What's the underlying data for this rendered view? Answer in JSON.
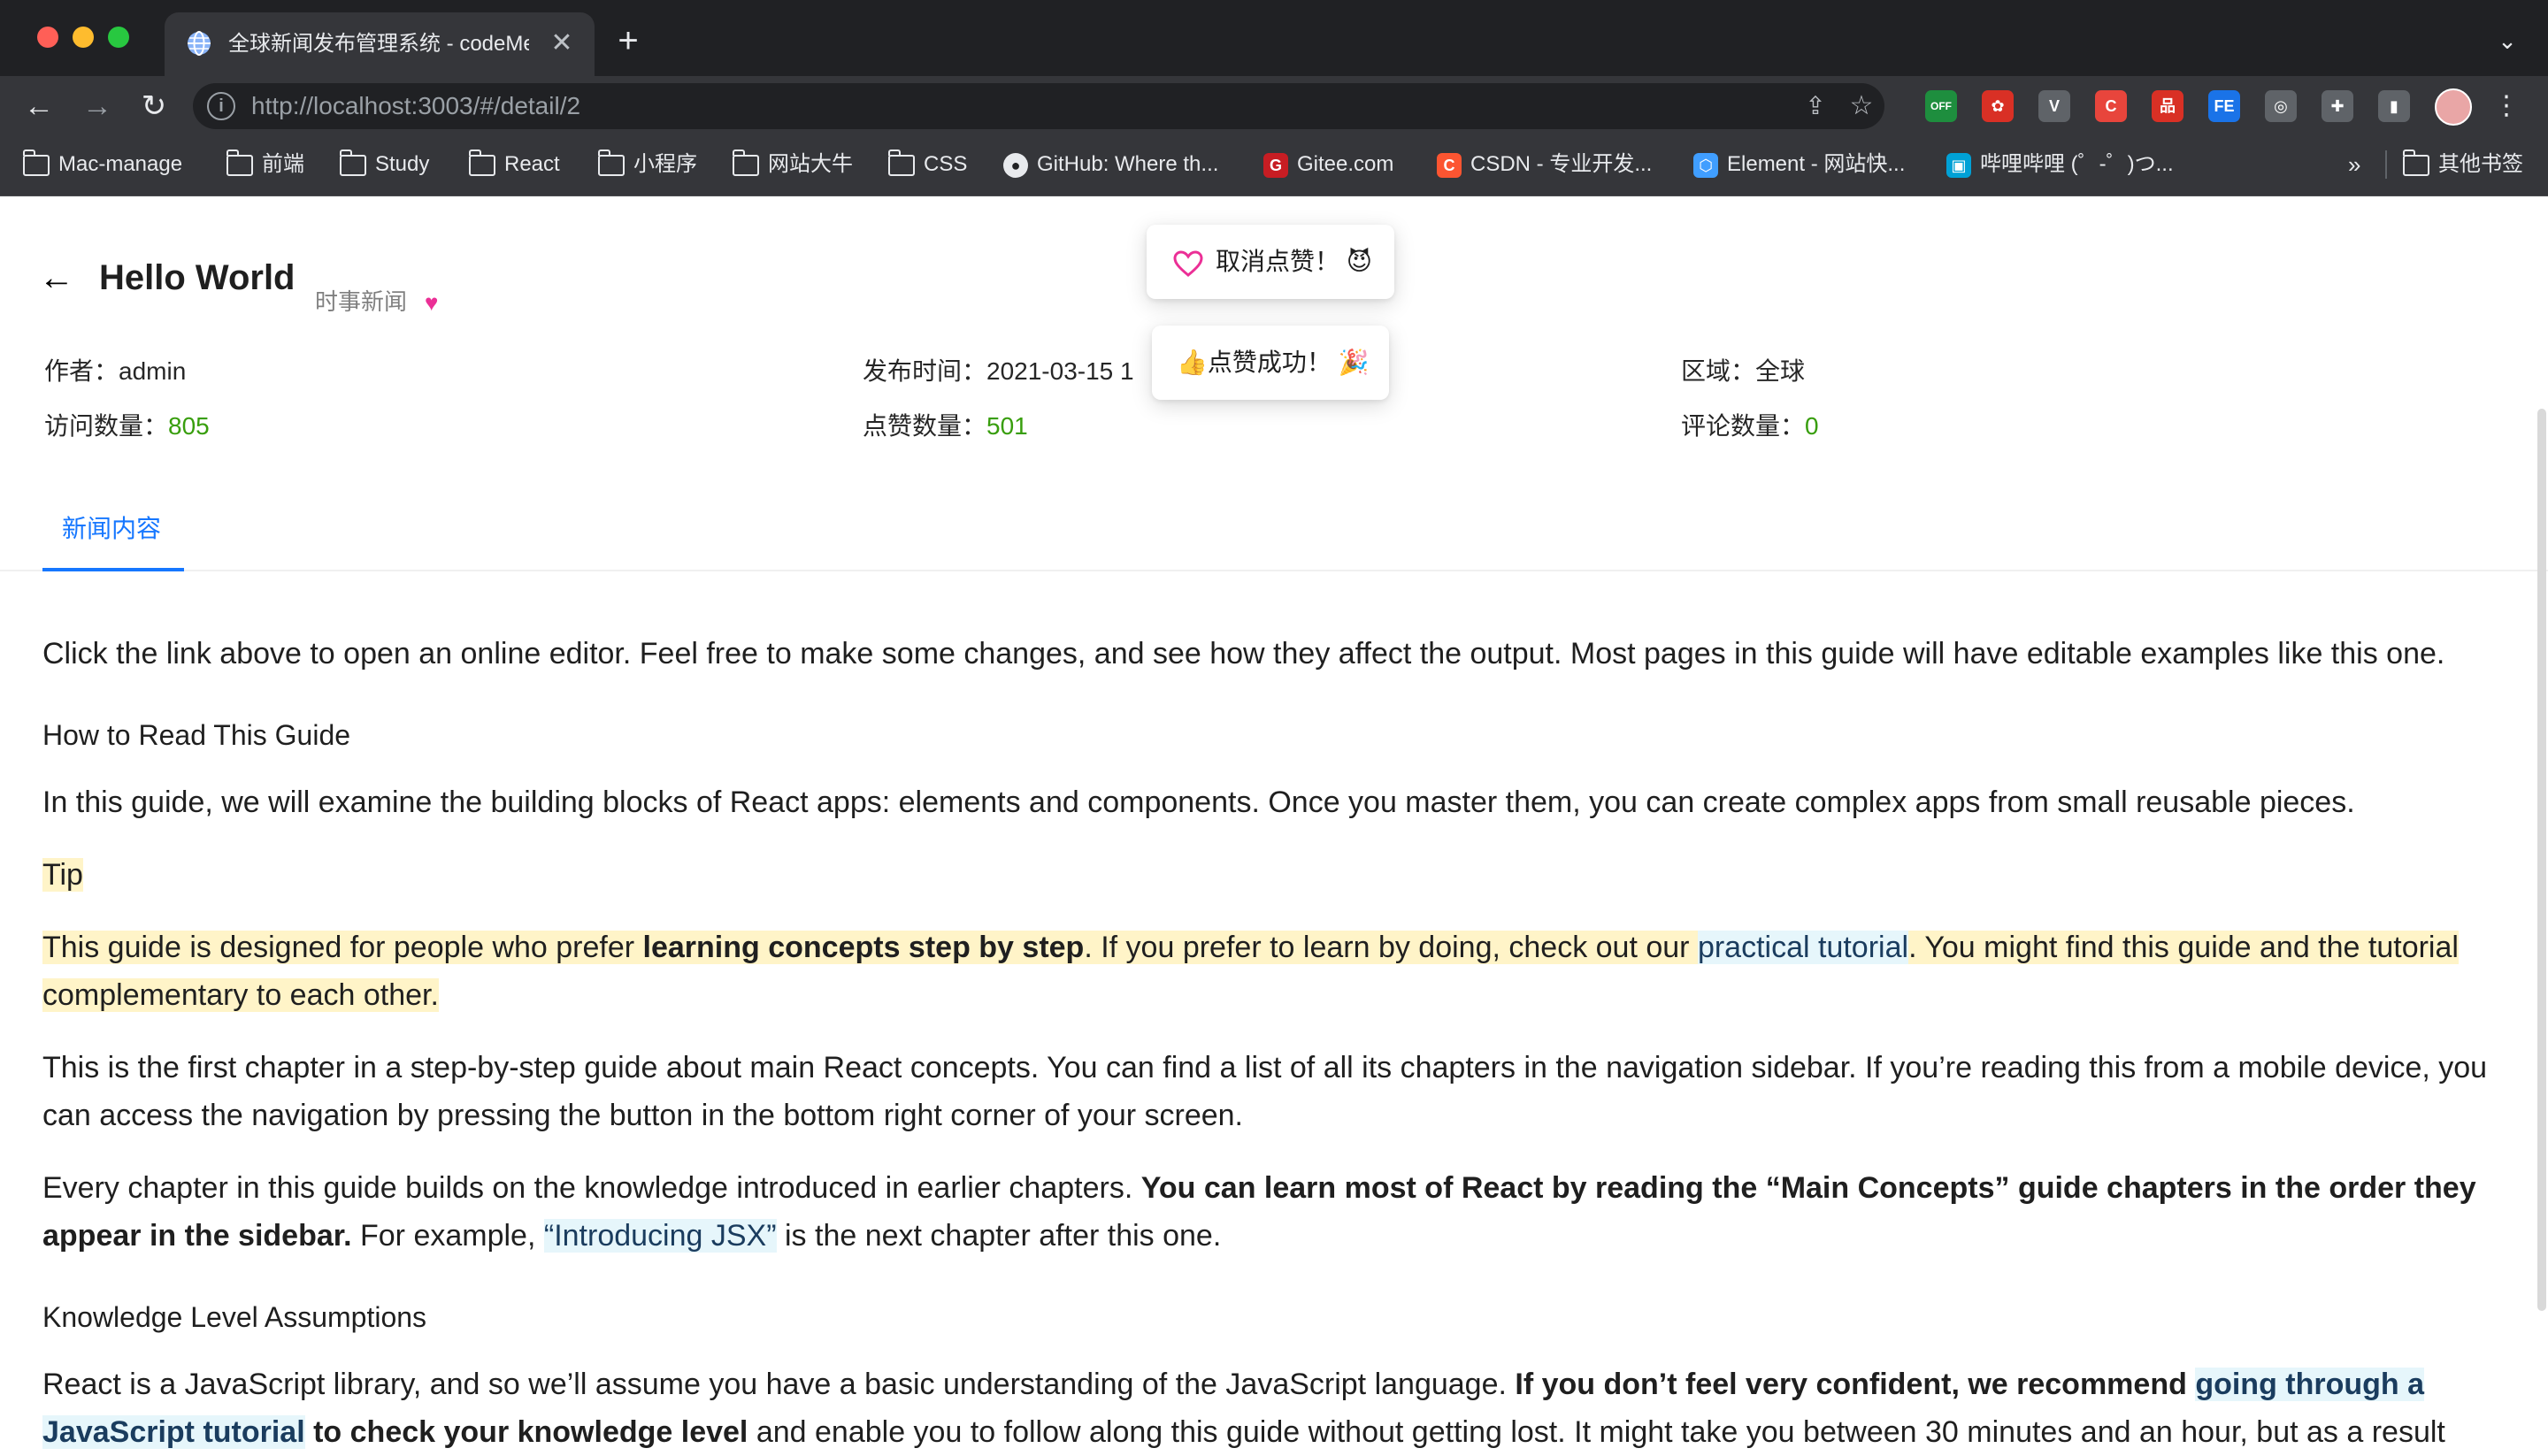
{
  "browser": {
    "tab_title": "全球新闻发布管理系统 - codeMe",
    "tab_close": "✕",
    "new_tab": "+",
    "url": "http://localhost:3003/#/detail/2",
    "extensions": [
      {
        "name": "off-extension",
        "text": "OFF",
        "color": "#1e8e3e"
      },
      {
        "name": "red-extension",
        "text": "✿",
        "color": "#d93025"
      },
      {
        "name": "vue-devtools",
        "text": "V",
        "color": "#5f6368"
      },
      {
        "name": "csdn-extension",
        "text": "C",
        "color": "#e8453c"
      },
      {
        "name": "red-grid-extension",
        "text": "品",
        "color": "#d93025"
      },
      {
        "name": "fe-extension",
        "text": "FE",
        "color": "#1a73e8"
      },
      {
        "name": "target-extension",
        "text": "◎",
        "color": "#5f6368"
      },
      {
        "name": "puzzle-extension",
        "text": "✚",
        "color": "#5f6368"
      },
      {
        "name": "sidepanel-extension",
        "text": "▮",
        "color": "#5f6368"
      }
    ],
    "bookmarks": [
      {
        "label": "Mac-manage",
        "icon": "folder-icon"
      },
      {
        "label": "前端",
        "icon": "folder-icon"
      },
      {
        "label": "Study",
        "icon": "folder-icon"
      },
      {
        "label": "React",
        "icon": "folder-icon"
      },
      {
        "label": "小程序",
        "icon": "folder-icon"
      },
      {
        "label": "网站大牛",
        "icon": "folder-icon"
      },
      {
        "label": "CSS",
        "icon": "folder-icon"
      },
      {
        "label": "GitHub: Where th...",
        "icon": "github-icon"
      },
      {
        "label": "Gitee.com",
        "icon": "gitee-icon"
      },
      {
        "label": "CSDN - 专业开发...",
        "icon": "csdn-icon"
      },
      {
        "label": "Element - 网站快...",
        "icon": "element-icon"
      },
      {
        "label": "哔哩哔哩 (゜-゜)つ...",
        "icon": "bilibili-icon"
      }
    ],
    "bookmarks_more": "»",
    "other_bookmarks": "其他书签"
  },
  "header": {
    "title": "Hello World",
    "category": "时事新闻",
    "heart": "♥"
  },
  "meta": {
    "author_label": "作者：",
    "author": "admin",
    "publish_label": "发布时间：",
    "publish_time": "2021-03-15 1",
    "region_label": "区域：",
    "region": "全球",
    "views_label": "访问数量：",
    "views": "805",
    "likes_label": "点赞数量：",
    "likes": "501",
    "comments_label": "评论数量：",
    "comments": "0"
  },
  "tabs": {
    "active": "新闻内容"
  },
  "messages": {
    "unlike": "取消点赞！",
    "unlike_emoji": "😈",
    "like_success": "点赞成功！",
    "like_emoji_start": "👍",
    "like_emoji_end": "🎉"
  },
  "content": {
    "p1": "Click the link above to open an online editor. Feel free to make some changes, and see how they affect the output. Most pages in this guide will have editable examples like this one.",
    "h1": "How to Read This Guide",
    "p2": "In this guide, we will examine the building blocks of React apps: elements and components. Once you master them, you can create complex apps from small reusable pieces.",
    "tip": "Tip",
    "tip_a": "This guide is designed for people who prefer ",
    "tip_b": "learning concepts step by step",
    "tip_c": ". If you prefer to learn by doing, check out our ",
    "tip_link": "practical tutorial",
    "tip_d": ". You might find this guide and the tutorial complementary to each other.",
    "p3": "This is the first chapter in a step-by-step guide about main React concepts. You can find a list of all its chapters in the navigation sidebar. If you’re reading this from a mobile device, you can access the navigation by pressing the button in the bottom right corner of your screen.",
    "p4_a": "Every chapter in this guide builds on the knowledge introduced in earlier chapters. ",
    "p4_b": "You can learn most of React by reading the “Main Concepts” guide chapters in the order they appear in the sidebar.",
    "p4_c": " For example, ",
    "p4_link": "“Introducing JSX”",
    "p4_d": " is the next chapter after this one.",
    "h2": "Knowledge Level Assumptions",
    "p5_a": "React is a JavaScript library, and so we’ll assume you have a basic understanding of the JavaScript language. ",
    "p5_b": "If you don’t feel very confident, we recommend ",
    "p5_link": "going through a JavaScript tutorial",
    "p5_c": " to check your knowledge level",
    "p5_d": " and enable you to follow along this guide without getting lost. It might take you between 30 minutes and an hour, but as a result"
  }
}
